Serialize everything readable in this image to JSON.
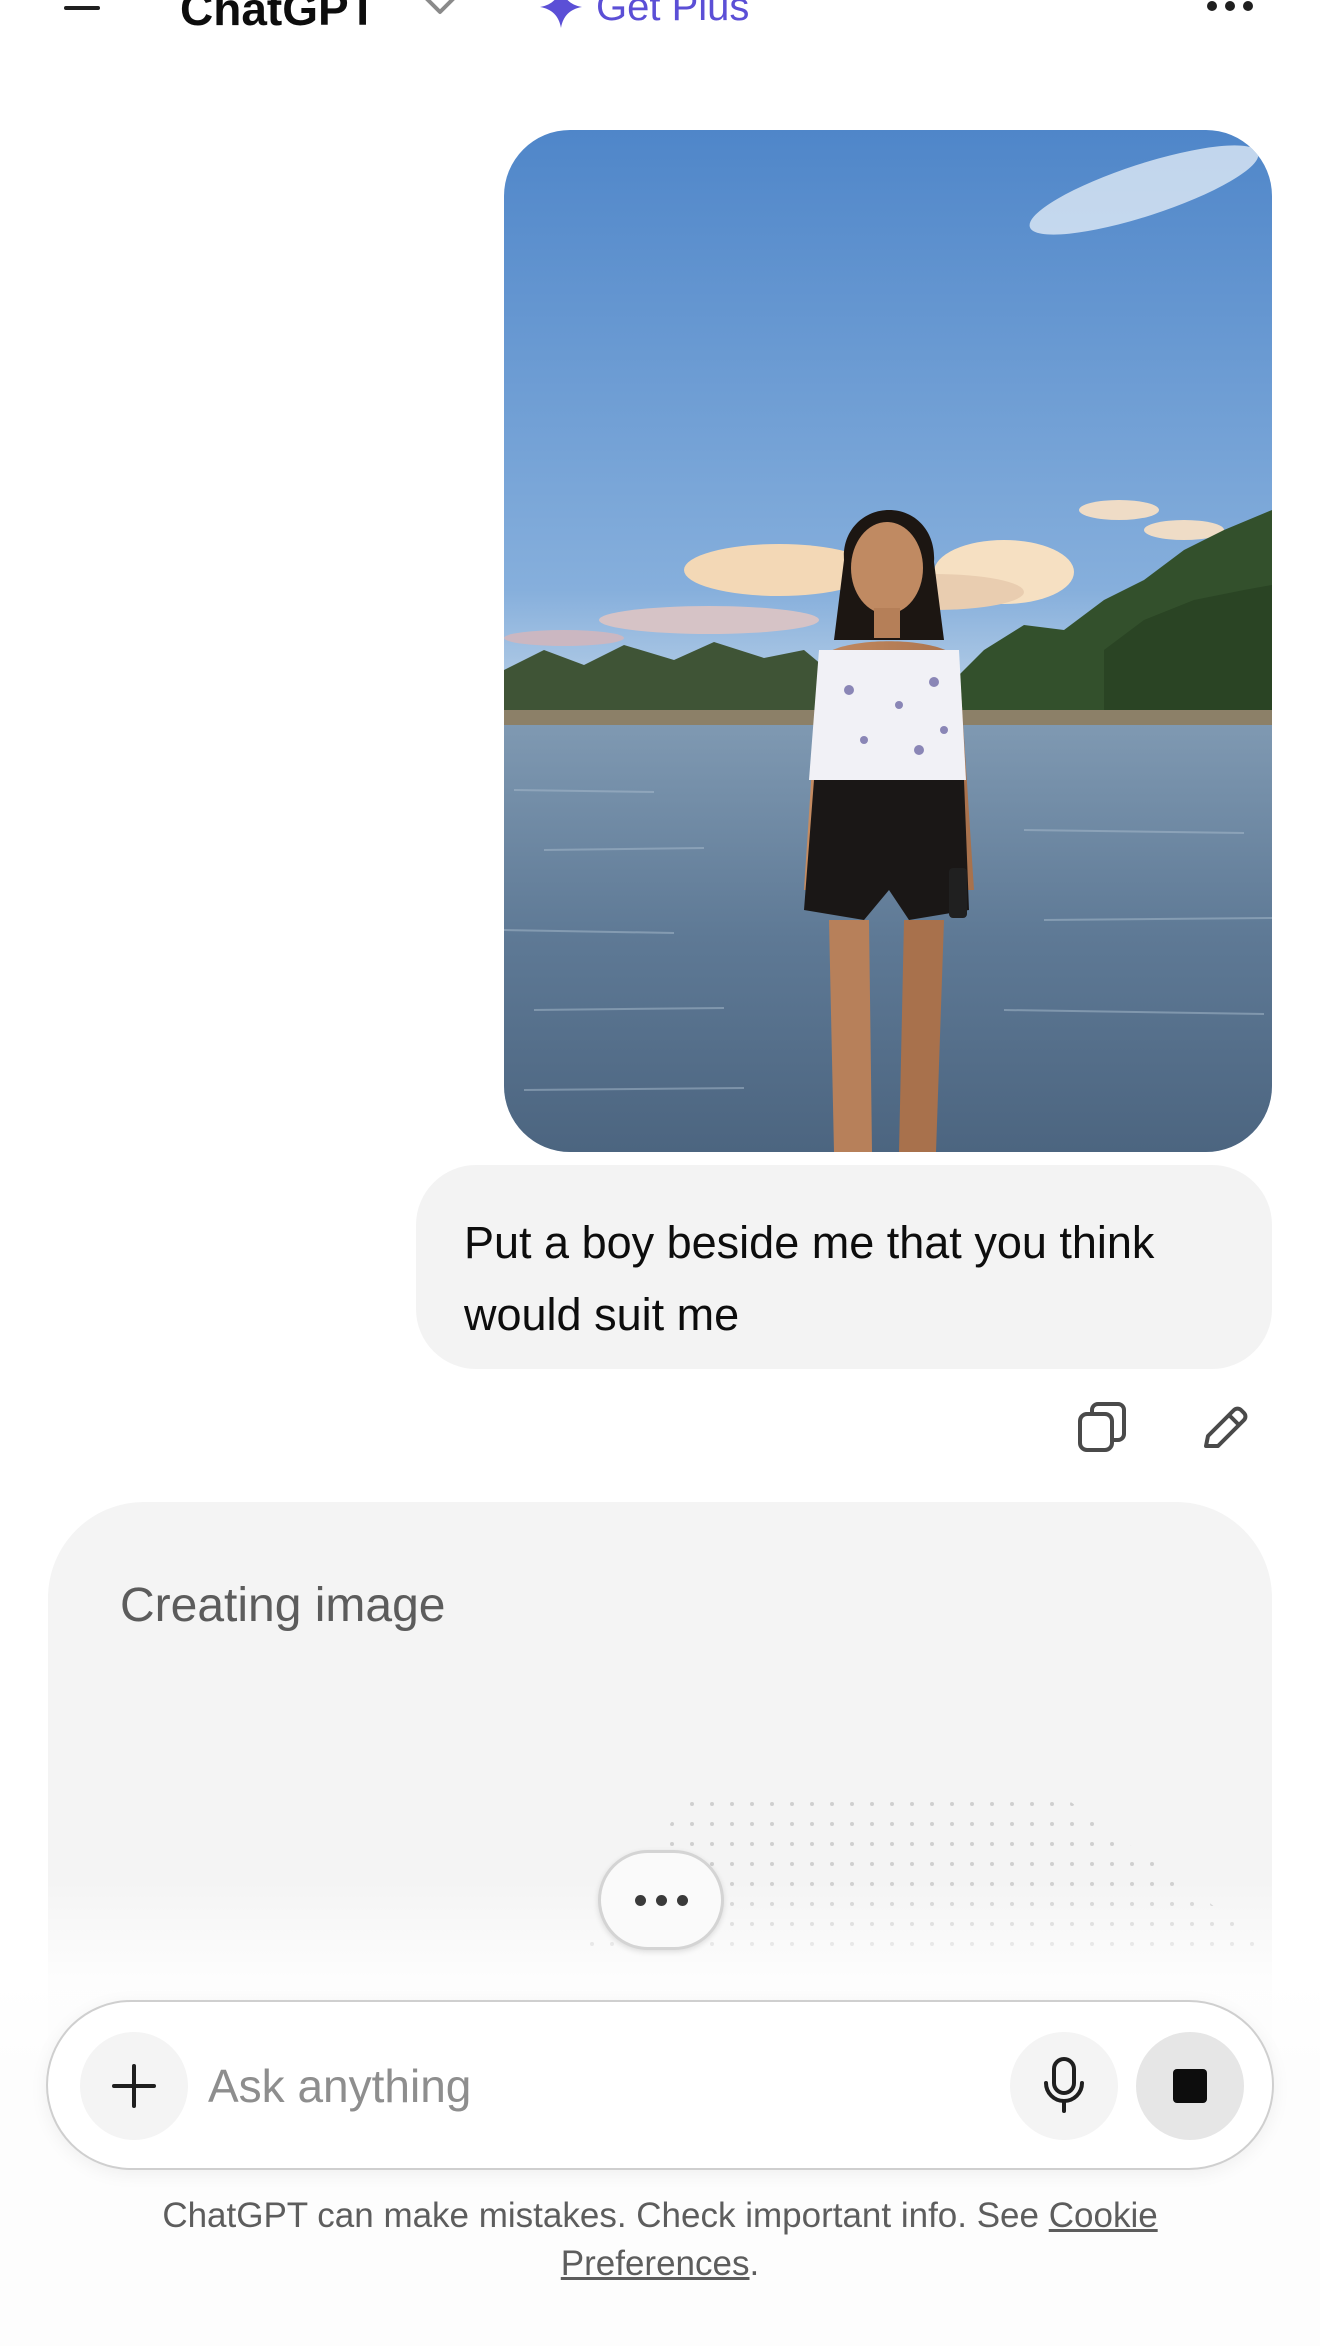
{
  "header": {
    "title": "ChatGPT",
    "upgrade_label": "Get Plus",
    "menu_icon": "menu-icon",
    "chevron_icon": "chevron-down-icon",
    "sparkle_icon": "sparkle-icon",
    "more_icon": "more-icon",
    "accent_color": "#5b4fd6"
  },
  "conversation": {
    "user_message": "Put a boy beside me that you think would suit me",
    "actions": [
      "copy-icon",
      "edit-icon"
    ],
    "assistant_status": "Creating image"
  },
  "composer": {
    "placeholder": "Ask anything",
    "add_icon": "plus-icon",
    "mic_icon": "mic-icon",
    "stop_icon": "stop-icon"
  },
  "footer": {
    "disclaimer": "ChatGPT can make mistakes. Check important info. See",
    "link_text": "Cookie Preferences",
    "trailing": "."
  }
}
